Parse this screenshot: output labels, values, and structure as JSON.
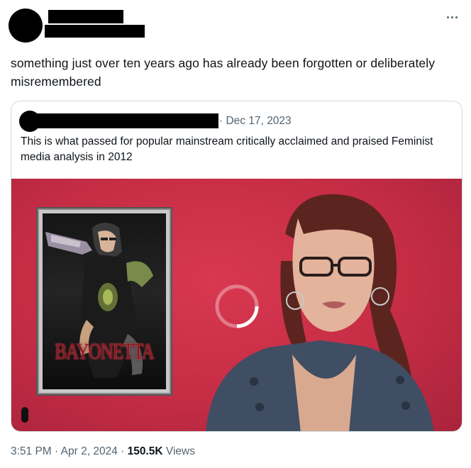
{
  "tweet": {
    "text": "something just over ten years ago has already been forgotten or deliberately misremembered",
    "time": "3:51 PM",
    "date": "Apr 2, 2024",
    "views_count": "150.5K",
    "views_label": "Views",
    "separator": "·"
  },
  "quoted": {
    "date": "· Dec 17, 2023",
    "text": "This is what passed for popular mainstream critically acclaimed and praised Feminist media analysis in 2012",
    "cover_title": "BAYONETTA"
  },
  "icons": {
    "more": "more-horizontal-icon",
    "loading": "loading-spinner-icon"
  },
  "colors": {
    "text_primary": "#0f1419",
    "text_secondary": "#536471",
    "border": "#cfd9de",
    "video_background": "#c52d45"
  }
}
